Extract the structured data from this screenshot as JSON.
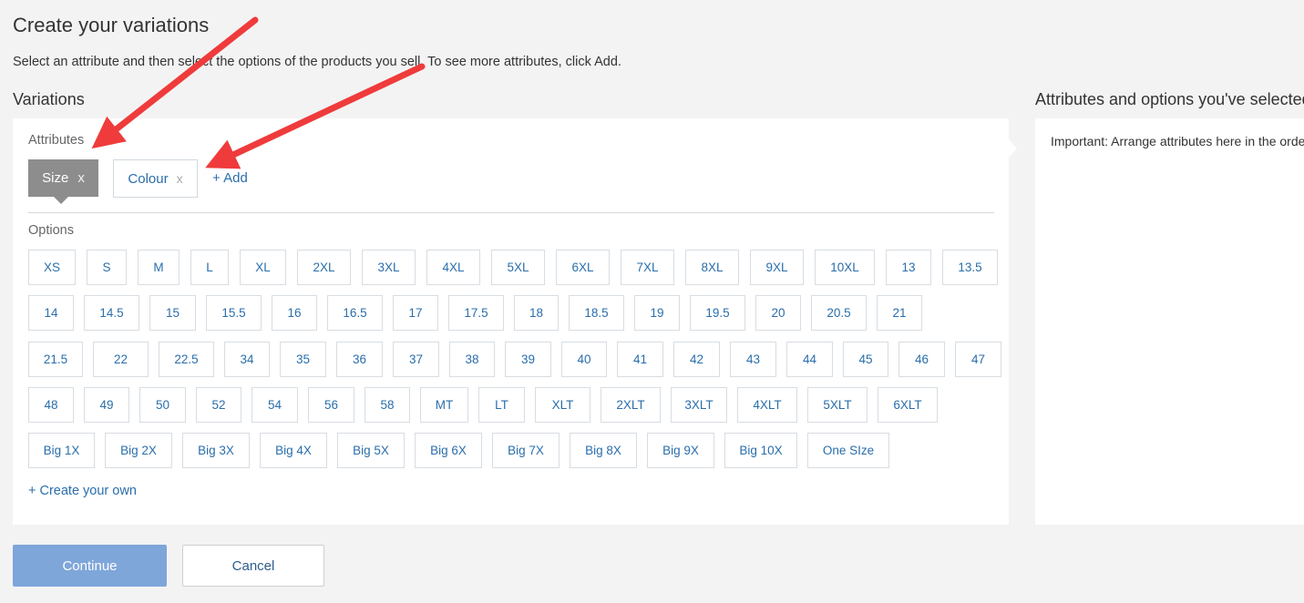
{
  "header": {
    "title": "Create your variations",
    "subtitle": "Select an attribute and then select the options of the products you sell. To see more attributes, click Add."
  },
  "variations": {
    "heading": "Variations",
    "attributes_label": "Attributes",
    "attributes": [
      {
        "label": "Size",
        "remove": "x",
        "selected": true
      },
      {
        "label": "Colour",
        "remove": "x",
        "selected": false
      }
    ],
    "add_label": "+ Add",
    "options_label": "Options",
    "option_rows": [
      [
        "XS",
        "S",
        "M",
        "L",
        "XL",
        "2XL",
        "3XL",
        "4XL",
        "5XL",
        "6XL",
        "7XL",
        "8XL",
        "9XL",
        "10XL",
        "13",
        "13.5"
      ],
      [
        "14",
        "14.5",
        "15",
        "15.5",
        "16",
        "16.5",
        "17",
        "17.5",
        "18",
        "18.5",
        "19",
        "19.5",
        "20",
        "20.5",
        "21"
      ],
      [
        "21.5",
        "22",
        "22.5",
        "34",
        "35",
        "36",
        "37",
        "38",
        "39",
        "40",
        "41",
        "42",
        "43",
        "44",
        "45",
        "46",
        "47"
      ],
      [
        "48",
        "49",
        "50",
        "52",
        "54",
        "56",
        "58",
        "MT",
        "LT",
        "XLT",
        "2XLT",
        "3XLT",
        "4XLT",
        "5XLT",
        "6XLT"
      ],
      [
        "Big 1X",
        "Big 2X",
        "Big 3X",
        "Big 4X",
        "Big 5X",
        "Big 6X",
        "Big 7X",
        "Big 8X",
        "Big 9X",
        "Big 10X",
        "One SIze"
      ]
    ],
    "create_own_label": "+ Create your own"
  },
  "selected_panel": {
    "heading": "Attributes and options you've selected",
    "note": "Important: Arrange attributes here in the order"
  },
  "actions": {
    "continue_label": "Continue",
    "cancel_label": "Cancel"
  },
  "colors": {
    "link": "#2a6eab",
    "selected_attribute": "#8d8d8d",
    "continue_button": "#7ea6d9",
    "annotation_arrow": "#ef3b3b"
  }
}
